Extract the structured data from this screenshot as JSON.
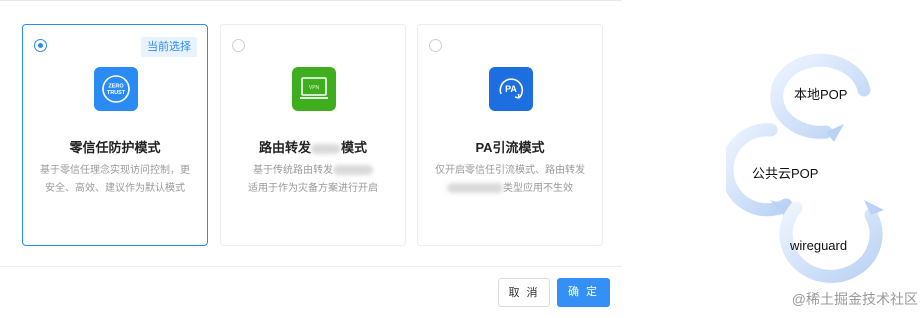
{
  "cards": [
    {
      "selected": true,
      "badge": "当前选择",
      "title": "零信任防护模式",
      "desc_line1": "基于零信任理念实现访问控制，更",
      "desc_line2": "安全、高效、建议作为默认模式",
      "icon": "zero-trust-icon",
      "icon_text_1": "ZERO",
      "icon_text_2": "TRUST"
    },
    {
      "selected": false,
      "title": "路由转发",
      "title_suffix": "模式",
      "desc_line1": "基于传统路由转发",
      "desc_line2": "适用于作为灾备方案进行开启",
      "icon": "vpn-icon",
      "icon_text": "VPN"
    },
    {
      "selected": false,
      "title": "PA引流模式",
      "desc_line1": "仅开启零信任引流模式、路由转发",
      "desc_line2": "类型应用不生效",
      "icon": "pa-icon",
      "icon_text": "PA"
    }
  ],
  "buttons": {
    "cancel": "取 消",
    "confirm": "确 定"
  },
  "flow": {
    "node1": "本地POP",
    "node2": "公共云POP",
    "node3": "wireguard"
  },
  "watermark": "@稀土掘金技术社区",
  "colors": {
    "accent": "#2b8bf5",
    "vpn_green": "#3fae1e",
    "pa_blue": "#1d6fe0"
  }
}
